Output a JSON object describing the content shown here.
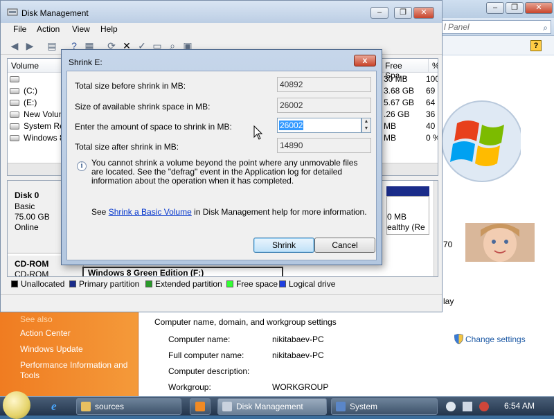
{
  "system_window": {
    "search_placeholder": "l Panel",
    "left_panel": {
      "see_also": "See also",
      "links": [
        "Action Center",
        "Windows Update",
        "Performance Information and",
        "Tools"
      ]
    },
    "section_title": "Computer name, domain, and workgroup settings",
    "rows": [
      {
        "label": "Computer name:",
        "value": "nikitabaev-PC"
      },
      {
        "label": "Full computer name:",
        "value": "nikitabaev-PC"
      },
      {
        "label": "Computer description:",
        "value": ""
      },
      {
        "label": "Workgroup:",
        "value": "WORKGROUP"
      }
    ],
    "change_settings": "Change settings",
    "partial_rating": "70",
    "partial_display": "lay"
  },
  "disk_management": {
    "title": "Disk Management",
    "menu": [
      "File",
      "Action",
      "View",
      "Help"
    ],
    "columns": {
      "volume": "Volume",
      "free_space": "Free Spa...",
      "percent_free": "% F"
    },
    "volumes": [
      {
        "name": "",
        "free": "30 MB",
        "pct": "100"
      },
      {
        "name": "(C:)",
        "free": "3.68 GB",
        "pct": "69"
      },
      {
        "name": "(E:)",
        "free": "5.67 GB",
        "pct": "64"
      },
      {
        "name": "New Volum",
        "free": ".26 GB",
        "pct": "36"
      },
      {
        "name": "System Res",
        "free": "MB",
        "pct": "40"
      },
      {
        "name": "Windows 8",
        "free": "MB",
        "pct": "0 %"
      }
    ],
    "disk0": {
      "name": "Disk 0",
      "type": "Basic",
      "size": "75.00 GB",
      "status": "Online"
    },
    "cdrom": {
      "name": "CD-ROM",
      "type": "CD-ROM"
    },
    "partition_partial": {
      "size": "0 MB",
      "status": "ealthy (Re"
    },
    "win8_partition": "Windows 8 Green Edition  (F:)",
    "legend": [
      {
        "label": "Unallocated",
        "color": "#000000"
      },
      {
        "label": "Primary partition",
        "color": "#1a2c8a"
      },
      {
        "label": "Extended partition",
        "color": "#2a9a2a"
      },
      {
        "label": "Free space",
        "color": "#33ff33"
      },
      {
        "label": "Logical drive",
        "color": "#1f3fe0"
      }
    ]
  },
  "shrink_dialog": {
    "title": "Shrink E:",
    "close_label": "x",
    "fields": [
      {
        "label": "Total size before shrink in MB:",
        "value": "40892"
      },
      {
        "label": "Size of available shrink space in MB:",
        "value": "26002"
      },
      {
        "label": "Enter the amount of space to shrink in MB:",
        "value": "26002"
      },
      {
        "label": "Total size after shrink in MB:",
        "value": "14890"
      }
    ],
    "info_text": "You cannot shrink a volume beyond the point where any unmovable files are located. See the \"defrag\" event in the Application log for detailed information about the operation when it has completed.",
    "help_prefix": "See ",
    "help_link": "Shrink a Basic Volume",
    "help_suffix": " in Disk Management help for more information.",
    "shrink_button": "Shrink",
    "cancel_button": "Cancel"
  },
  "taskbar": {
    "items": [
      {
        "label": "sources",
        "active": false
      },
      {
        "label": "",
        "active": false
      },
      {
        "label": "Disk Management",
        "active": true
      },
      {
        "label": "System",
        "active": false
      }
    ],
    "clock": "6:54 AM"
  },
  "colors": {
    "accent_orange": "#f07c21",
    "titlebar_blue": "#bccee4",
    "link_blue": "#0033cc",
    "selection_blue": "#3399ff"
  }
}
